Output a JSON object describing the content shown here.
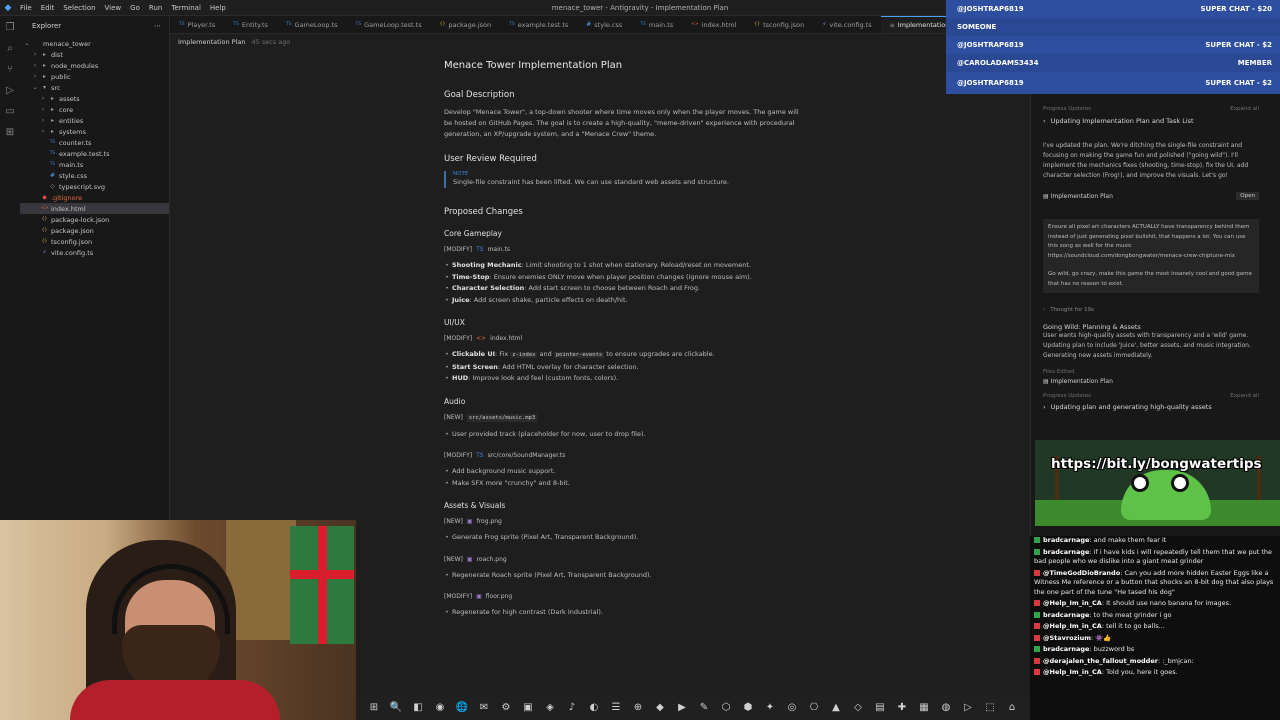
{
  "window": {
    "title": "menace_tower - Antigravity - Implementation Plan",
    "menu": [
      "File",
      "Edit",
      "Selection",
      "View",
      "Go",
      "Run",
      "Terminal",
      "Help"
    ]
  },
  "explorer": {
    "title": "Explorer",
    "items": [
      {
        "label": "menace_tower",
        "depth": 0,
        "chev": "⌄",
        "icon": ""
      },
      {
        "label": "dist",
        "depth": 1,
        "chev": "›",
        "icon": "▸"
      },
      {
        "label": "node_modules",
        "depth": 1,
        "chev": "›",
        "icon": "▸"
      },
      {
        "label": "public",
        "depth": 1,
        "chev": "›",
        "icon": "▸"
      },
      {
        "label": "src",
        "depth": 1,
        "chev": "⌄",
        "icon": "▾"
      },
      {
        "label": "assets",
        "depth": 2,
        "chev": "›",
        "icon": "▸"
      },
      {
        "label": "core",
        "depth": 2,
        "chev": "›",
        "icon": "▸"
      },
      {
        "label": "entities",
        "depth": 2,
        "chev": "›",
        "icon": "▸"
      },
      {
        "label": "systems",
        "depth": 2,
        "chev": "›",
        "icon": "▸"
      },
      {
        "label": "counter.ts",
        "depth": 2,
        "chev": "",
        "icon": "TS"
      },
      {
        "label": "example.test.ts",
        "depth": 2,
        "chev": "",
        "icon": "TS"
      },
      {
        "label": "main.ts",
        "depth": 2,
        "chev": "",
        "icon": "TS"
      },
      {
        "label": "style.css",
        "depth": 2,
        "chev": "",
        "icon": "#"
      },
      {
        "label": "typescript.svg",
        "depth": 2,
        "chev": "",
        "icon": "◇"
      },
      {
        "label": ".gitignore",
        "depth": 1,
        "chev": "",
        "icon": "◆"
      },
      {
        "label": "index.html",
        "depth": 1,
        "chev": "",
        "icon": "<>"
      },
      {
        "label": "package-lock.json",
        "depth": 1,
        "chev": "",
        "icon": "{}"
      },
      {
        "label": "package.json",
        "depth": 1,
        "chev": "",
        "icon": "{}"
      },
      {
        "label": "tsconfig.json",
        "depth": 1,
        "chev": "",
        "icon": "{}"
      },
      {
        "label": "vite.config.ts",
        "depth": 1,
        "chev": "",
        "icon": "⚡"
      }
    ]
  },
  "tabs": [
    {
      "label": "Player.ts",
      "icon": "TS"
    },
    {
      "label": "Entity.ts",
      "icon": "TS"
    },
    {
      "label": "GameLoop.ts",
      "icon": "TS"
    },
    {
      "label": "GameLoop.test.ts",
      "icon": "TS"
    },
    {
      "label": "package.json",
      "icon": "{}"
    },
    {
      "label": "example.test.ts",
      "icon": "TS"
    },
    {
      "label": "style.css",
      "icon": "#"
    },
    {
      "label": "main.ts",
      "icon": "TS"
    },
    {
      "label": "index.html",
      "icon": "<>"
    },
    {
      "label": "tsconfig.json",
      "icon": "{}"
    },
    {
      "label": "vite.config.ts",
      "icon": "⚡"
    },
    {
      "label": "Implementation",
      "icon": "≡"
    }
  ],
  "breadcrumb": {
    "label": "Implementation Plan",
    "meta": "45 secs ago"
  },
  "doc": {
    "title": "Menace Tower Implementation Plan",
    "goal_heading": "Goal Description",
    "goal_text": "Develop \"Menace Tower\", a top-down shooter where time moves only when the player moves. The game will be hosted on GitHub Pages. The goal is to create a high-quality, \"meme-driven\" experience with procedural generation, an XP/upgrade system, and a \"Menace Crew\" theme.",
    "review_heading": "User Review Required",
    "note_label": "NOTE",
    "note_text": "Single-file constraint has been lifted. We can use standard web assets and structure.",
    "changes_heading": "Proposed Changes",
    "core_heading": "Core Gameplay",
    "core_file_tag": "[MODIFY]",
    "core_file": "main.ts",
    "core_items": [
      {
        "b": "Shooting Mechanic",
        "t": ": Limit shooting to 1 shot when stationary. Reload/reset on movement."
      },
      {
        "b": "Time-Stop",
        "t": ": Ensure enemies ONLY move when player position changes (ignore mouse aim)."
      },
      {
        "b": "Character Selection",
        "t": ": Add start screen to choose between Roach and Frog."
      },
      {
        "b": "Juice",
        "t": ": Add screen shake, particle effects on death/hit."
      }
    ],
    "uiux_heading": "UI/UX",
    "uiux_file_tag": "[MODIFY]",
    "uiux_file": "index.html",
    "uiux_items": [
      {
        "b": "Clickable UI",
        "t": ": Fix ",
        "c1": "z-index",
        "m": " and ",
        "c2": "pointer-events",
        "e": " to ensure upgrades are clickable."
      },
      {
        "b": "Start Screen",
        "t": ": Add HTML overlay for character selection."
      },
      {
        "b": "HUD",
        "t": ": Improve look and feel (custom fonts, colors)."
      }
    ],
    "audio_heading": "Audio",
    "audio_file1_tag": "[NEW]",
    "audio_file1": "src/assets/music.mp3",
    "audio_item1": "User provided track (placeholder for now, user to drop file).",
    "audio_file2_tag": "[MODIFY]",
    "audio_file2": "src/core/SoundManager.ts",
    "audio_items2": [
      "Add background music support.",
      "Make SFX more \"crunchy\" and 8-bit."
    ],
    "assets_heading": "Assets & Visuals",
    "assets_file1_tag": "[NEW]",
    "assets_file1": "frog.png",
    "assets_item1": "Generate Frog sprite (Pixel Art, Transparent Background).",
    "assets_file2_tag": "[NEW]",
    "assets_file2": "roach.png",
    "assets_item2": "Regenerate Roach sprite (Pixel Art, Transparent Background).",
    "assets_file3_tag": "[MODIFY]",
    "assets_file3": "floor.png",
    "assets_item3": "Regenerate for high contrast (Dark Industrial)."
  },
  "agent": {
    "progress_label": "Progress Updates",
    "expand_label": "Expand all",
    "task1": "Updating Implementation Plan and Task List",
    "msg1": "I've updated the plan. We're ditching the single-file constraint and focusing on making the game fun and polished (\"going wild\"). I'll implement the mechanics fixes (shooting, time-stop), fix the UI, add character selection (Frog!), and improve the visuals. Let's go!",
    "artifact": "Implementation Plan",
    "open": "Open",
    "user_msg1": "Ensure all pixel art characters ACTUALLY have transparency behind them instead of just generating pixel bullshit, that happens a lot. You can use this song as well for the music https://soundcloud.com/dongbongwater/menace-crew-chiptune-mix",
    "user_msg2": "Go wild, go crazy, make this game the most insanely cool and good game that has no reason to exist.",
    "thought": "Thought for 19s",
    "planning_heading": "Going Wild: Planning & Assets",
    "planning_text": "User wants high-quality assets with transparency and a 'wild' game. Updating plan to include 'Juice', better assets, and music integration. Generating new assets immediately.",
    "files_edited": "Files Edited",
    "edited_file": "Implementation Plan",
    "progress2_label": "Progress Updates",
    "expand2_label": "Expand all",
    "task2": "Updating plan and generating high-quality assets"
  },
  "superchats": [
    {
      "user": "@JOSHTRAP6819",
      "amount": "SUPER CHAT - $20"
    },
    {
      "user": "SOMEONE",
      "amount": ""
    },
    {
      "user": "@JOSHTRAP6819",
      "amount": "SUPER CHAT - $2"
    },
    {
      "user": "@CAROLADAMS3434",
      "amount": "MEMBER"
    },
    {
      "user": "@JOSHTRAP6819",
      "amount": "SUPER CHAT - $2"
    }
  ],
  "promo": {
    "url": "https://bit.ly/bongwatertips"
  },
  "chat": [
    {
      "user": "bradcarnage",
      "text": ": and make them fear it",
      "platform": "tw"
    },
    {
      "user": "bradcarnage",
      "text": ": if i have kids i will repeatedly tell them that we put the bad people who we dislike into a giant meat grinder",
      "platform": "tw"
    },
    {
      "user": "@TimeGodDioBrando",
      "text": ": Can you add more hidden Easter Eggs like a Witness Me reference or a button that shocks an 8-bit dog that also plays the one part of the tune \"He tased his dog\"",
      "platform": "yt"
    },
    {
      "user": "@Help_Im_in_CA",
      "text": ": It should use nano banana for images.",
      "platform": "yt"
    },
    {
      "user": "bradcarnage",
      "text": ": to the meat grinder i go",
      "platform": "tw"
    },
    {
      "user": "@Help_Im_in_CA",
      "text": ": tell it to go balls...",
      "platform": "yt"
    },
    {
      "user": "@Stavrozium",
      "text": ": 👾👍",
      "platform": "yt"
    },
    {
      "user": "bradcarnage",
      "text": ": buzzword bs",
      "platform": "tw"
    },
    {
      "user": "@derajalen_the_fallout_modder",
      "text": ": :_bmjcan:",
      "platform": "yt"
    },
    {
      "user": "@Help_Im_in_CA",
      "text": ": Told you, here it goes.",
      "platform": "yt"
    }
  ],
  "taskbar": {
    "icons": [
      "⊞",
      "🔍",
      "◧",
      "◉",
      "🌐",
      "✉",
      "⚙",
      "▣",
      "◈",
      "♪",
      "◐",
      "☰",
      "⊕",
      "◆",
      "▶",
      "✎",
      "⬡",
      "⬢",
      "✦",
      "◎",
      "⎔",
      "▲",
      "◇",
      "▤",
      "✚",
      "▦",
      "◍",
      "▷",
      "⬚",
      "⌂"
    ]
  }
}
